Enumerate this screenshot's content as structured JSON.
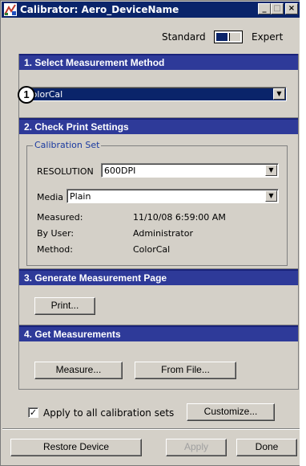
{
  "window": {
    "title": "Calibrator: Aero_DeviceName",
    "min_label": "_",
    "max_label": "□",
    "close_label": "×"
  },
  "mode": {
    "standard_label": "Standard",
    "expert_label": "Expert",
    "selected": "Standard"
  },
  "section1": {
    "header": "1. Select Measurement Method",
    "method_value": "ColorCal",
    "badge": "1"
  },
  "section2": {
    "header": "2. Check Print Settings",
    "group_label": "Calibration Set",
    "resolution_label": "RESOLUTION",
    "resolution_value": "600DPI",
    "media_label": "Media",
    "media_value": "Plain",
    "measured_label": "Measured:",
    "measured_value": "11/10/08 6:59:00 AM",
    "by_user_label": "By User:",
    "by_user_value": "Administrator",
    "method_label": "Method:",
    "method_value": "ColorCal"
  },
  "section3": {
    "header": "3. Generate Measurement Page",
    "print_label": "Print..."
  },
  "section4": {
    "header": "4. Get Measurements",
    "measure_label": "Measure...",
    "from_file_label": "From File..."
  },
  "footer": {
    "apply_all_checked": true,
    "apply_all_label": "Apply to all calibration sets",
    "customize_label": "Customize...",
    "restore_label": "Restore Device",
    "apply_label": "Apply",
    "done_label": "Done"
  },
  "colors": {
    "title_bar": "#0a246a",
    "section_header": "#2e3a99",
    "face": "#d4d0c8"
  }
}
